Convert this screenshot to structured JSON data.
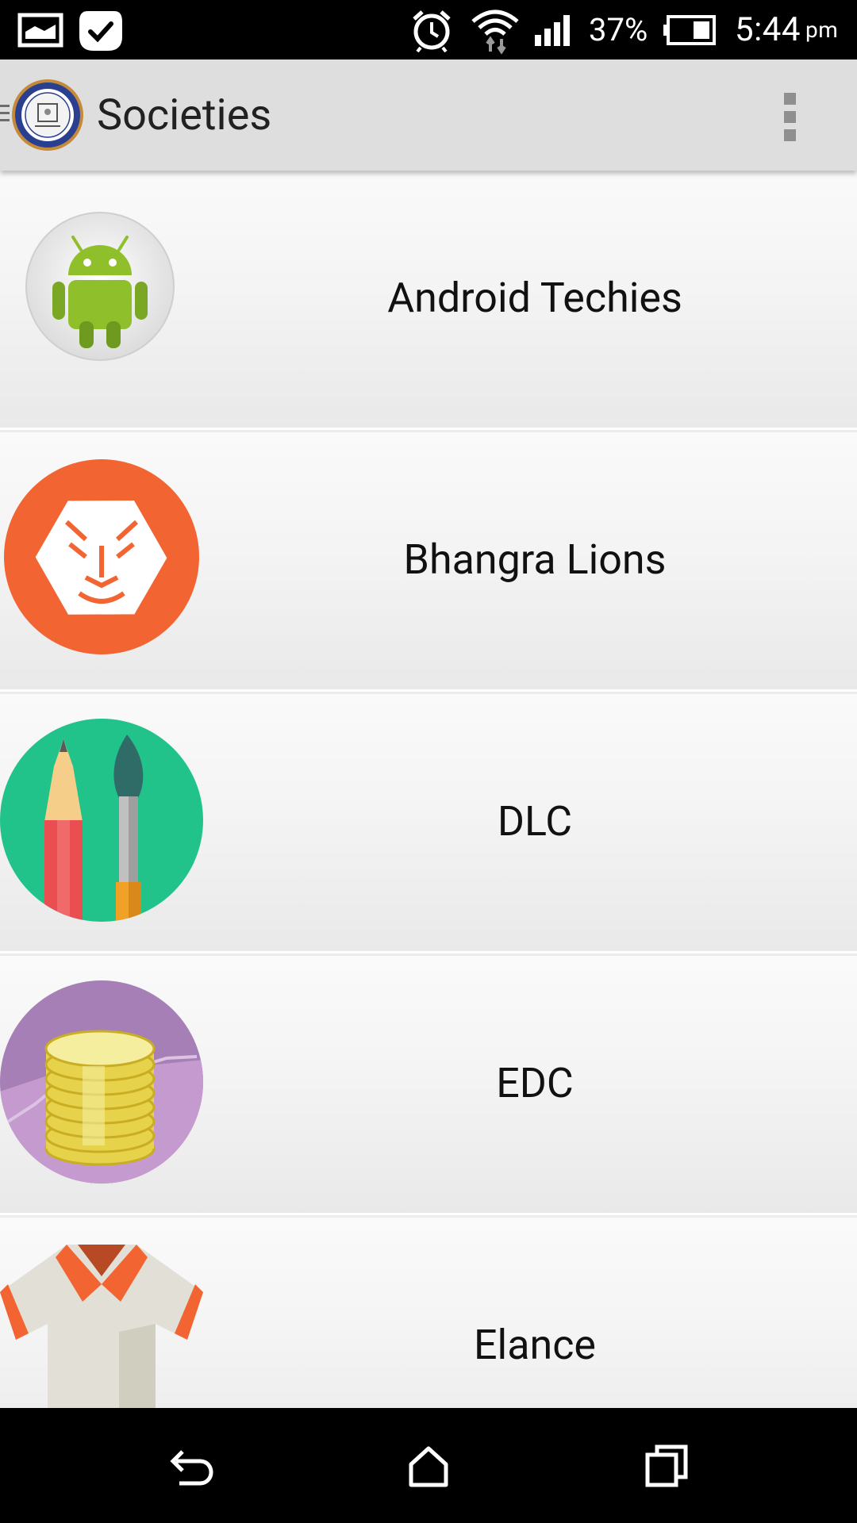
{
  "status_bar": {
    "battery_percent": "37%",
    "time": "5:44",
    "ampm": "pm",
    "icons": [
      "screenshot-icon",
      "task-check-icon",
      "alarm-icon",
      "wifi-icon",
      "signal-icon",
      "battery-icon"
    ]
  },
  "app_bar": {
    "title": "Societies",
    "logo": "college-emblem-logo",
    "menu": "overflow-menu-icon"
  },
  "societies": [
    {
      "name": "Android Techies",
      "icon": "android-robot-icon"
    },
    {
      "name": "Bhangra Lions",
      "icon": "lion-face-icon"
    },
    {
      "name": "DLC",
      "icon": "pencil-brush-icon"
    },
    {
      "name": "EDC",
      "icon": "coin-stack-icon"
    },
    {
      "name": "Elance",
      "icon": "polo-shirt-icon"
    }
  ],
  "nav_bar": {
    "back": "back-icon",
    "home": "home-icon",
    "recents": "recents-icon"
  },
  "colors": {
    "app_bar": "#dedede",
    "status_bar": "#000000",
    "android_green": "#8fbf2b",
    "lion_orange": "#f26532",
    "dlc_green": "#21c38b",
    "edc_purple": "#a57fb6"
  }
}
